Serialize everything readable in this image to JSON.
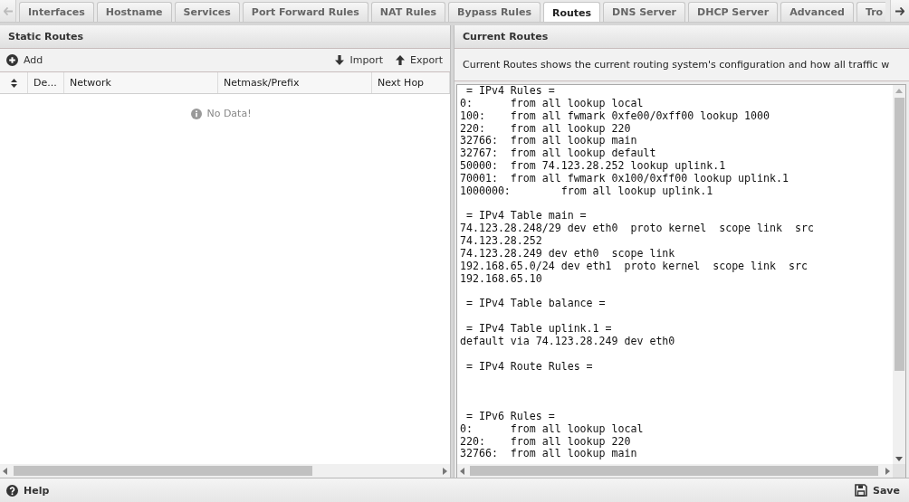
{
  "tabs": {
    "scroll_left": {
      "disabled": true
    },
    "scroll_right": {
      "disabled": false
    },
    "items": [
      {
        "label": "Interfaces",
        "selected": false
      },
      {
        "label": "Hostname",
        "selected": false
      },
      {
        "label": "Services",
        "selected": false
      },
      {
        "label": "Port Forward Rules",
        "selected": false
      },
      {
        "label": "NAT Rules",
        "selected": false
      },
      {
        "label": "Bypass Rules",
        "selected": false
      },
      {
        "label": "Routes",
        "selected": true
      },
      {
        "label": "DNS Server",
        "selected": false
      },
      {
        "label": "DHCP Server",
        "selected": false
      },
      {
        "label": "Advanced",
        "selected": false
      },
      {
        "label": "Tro",
        "selected": false
      }
    ]
  },
  "static_routes": {
    "title": "Static Routes",
    "toolbar": {
      "left": [
        {
          "kind": "add",
          "label": "Add"
        }
      ],
      "right": [
        {
          "kind": "import",
          "label": "Import"
        },
        {
          "kind": "export",
          "label": "Export"
        }
      ]
    },
    "columns": [
      {
        "label": "De..."
      },
      {
        "label": "Network"
      },
      {
        "label": "Netmask/Prefix"
      },
      {
        "label": "Next Hop"
      }
    ],
    "empty_message": "No Data!"
  },
  "current_routes": {
    "title": "Current Routes",
    "description": "Current Routes shows the current routing system's configuration and how all traffic w",
    "output": " = IPv4 Rules =\n0:\tfrom all lookup local\n100:\tfrom all fwmark 0xfe00/0xff00 lookup 1000\n220:\tfrom all lookup 220\n32766:\tfrom all lookup main\n32767:\tfrom all lookup default\n50000:\tfrom 74.123.28.252 lookup uplink.1\n70001:\tfrom all fwmark 0x100/0xff00 lookup uplink.1\n1000000:\tfrom all lookup uplink.1\n\n = IPv4 Table main =\n74.123.28.248/29 dev eth0  proto kernel  scope link  src\n74.123.28.252\n74.123.28.249 dev eth0  scope link\n192.168.65.0/24 dev eth1  proto kernel  scope link  src\n192.168.65.10\n\n = IPv4 Table balance =\n\n = IPv4 Table uplink.1 =\ndefault via 74.123.28.249 dev eth0\n\n = IPv4 Route Rules =\n\n\n\n = IPv6 Rules =\n0:\tfrom all lookup local\n220:\tfrom all lookup 220\n32766:\tfrom all lookup main"
  },
  "footer": {
    "left": [
      {
        "kind": "help",
        "label": "Help"
      }
    ],
    "right": [
      {
        "kind": "save",
        "label": "Save"
      }
    ]
  }
}
